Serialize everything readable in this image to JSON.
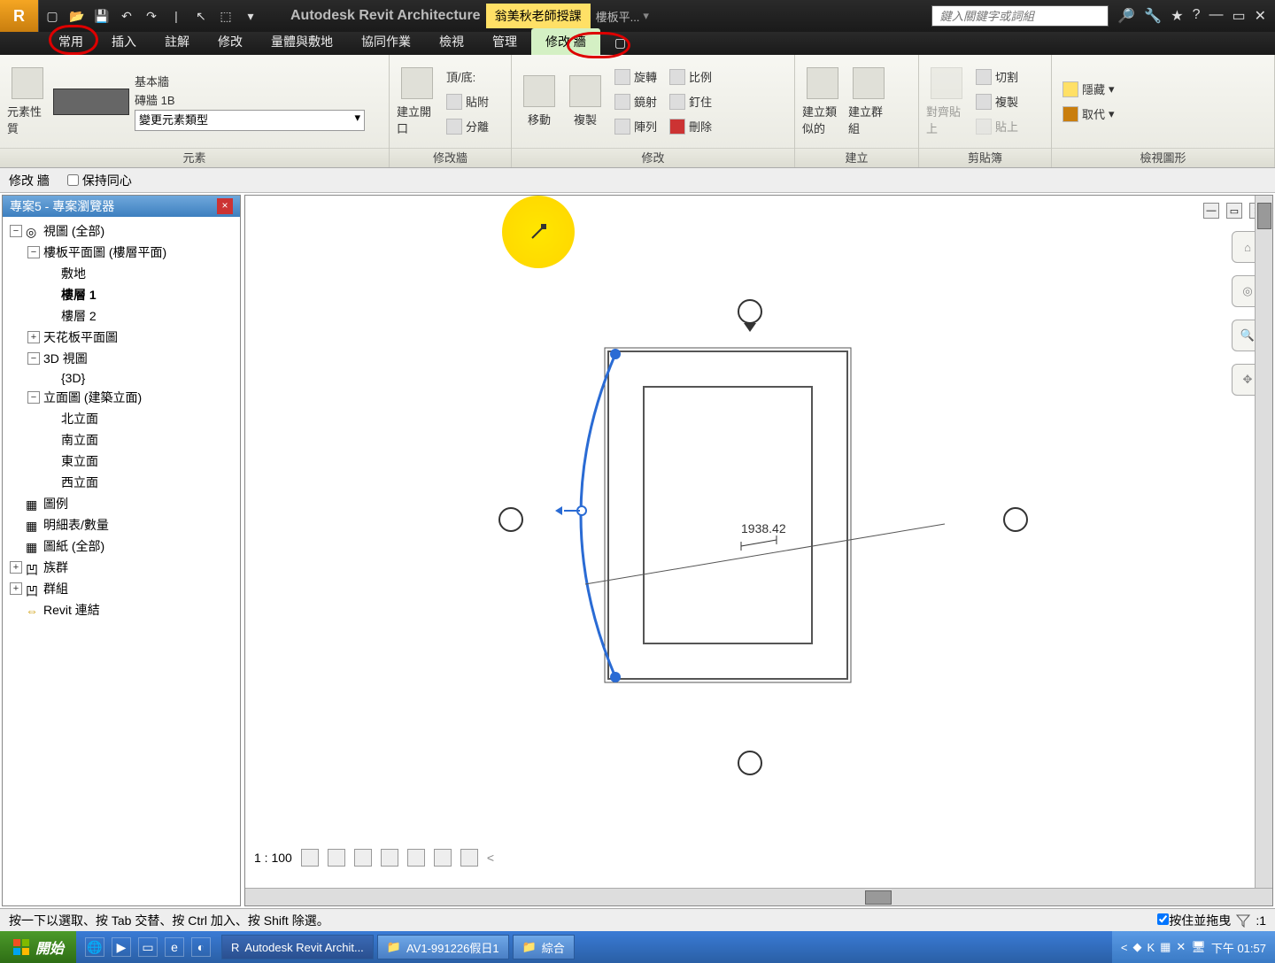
{
  "app": {
    "title": "Autodesk Revit Architecture",
    "badge": "翁美秋老師授課",
    "doc": "樓板平...",
    "search_placeholder": "鍵入關鍵字或詞組"
  },
  "tabs": [
    "常用",
    "插入",
    "註解",
    "修改",
    "量體與敷地",
    "協同作業",
    "檢視",
    "管理",
    "修改 牆"
  ],
  "active_tab": 8,
  "element_panel": {
    "btn": "元素性質",
    "label1": "基本牆",
    "label2": "磚牆 1B",
    "combo": "變更元素類型",
    "title": "元素"
  },
  "modify_wall_panel": {
    "btn": "建立開口",
    "r1": "頂/底:",
    "r2": "貼附",
    "r3": "分離",
    "title": "修改牆"
  },
  "modify_panel": {
    "move": "移動",
    "copy": "複製",
    "rotate": "旋轉",
    "scale": "比例",
    "mirror": "鏡射",
    "pin": "釘住",
    "array": "陣列",
    "delete": "刪除",
    "title": "修改"
  },
  "create_panel": {
    "similar": "建立類似的",
    "group": "建立群組",
    "title": "建立"
  },
  "clipboard_panel": {
    "align": "對齊貼上",
    "cut": "切割",
    "copy": "複製",
    "paste": "貼上",
    "title": "剪貼簿"
  },
  "view_panel": {
    "hide": "隱藏",
    "override": "取代",
    "title": "檢視圖形"
  },
  "options": {
    "context": "修改 牆",
    "check": "保持同心"
  },
  "browser": {
    "title": "專案5 - 專案瀏覽器",
    "views_root": "視圖 (全部)",
    "floor_plans": "樓板平面圖 (樓層平面)",
    "site": "敷地",
    "level1": "樓層 1",
    "level2": "樓層 2",
    "ceiling": "天花板平面圖",
    "view3d": "3D 視圖",
    "view3d_item": "{3D}",
    "elev": "立面圖 (建築立面)",
    "elev_n": "北立面",
    "elev_s": "南立面",
    "elev_e": "東立面",
    "elev_w": "西立面",
    "legends": "圖例",
    "schedules": "明細表/數量",
    "sheets": "圖紙 (全部)",
    "families": "族群",
    "groups": "群組",
    "links": "Revit 連結"
  },
  "canvas": {
    "dimension": "1938.42",
    "scale": "1 : 100"
  },
  "status": {
    "hint": "按一下以選取、按 Tab 交替、按 Ctrl 加入、按 Shift 除選。",
    "drag": "按住並拖曳",
    "filter_count": ":1"
  },
  "taskbar": {
    "start": "開始",
    "tasks": [
      "Autodesk Revit Archit...",
      "AV1-991226假日1",
      "綜合"
    ],
    "clock": "下午 01:57"
  }
}
